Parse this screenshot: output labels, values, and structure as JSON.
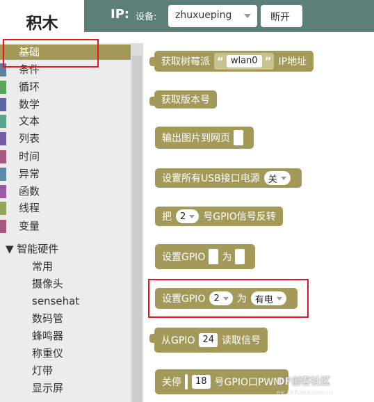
{
  "sidebar": {
    "title": "积木",
    "categories": [
      {
        "label": "基础",
        "color": "#a39a59"
      },
      {
        "label": "条件",
        "color": "#5b80a5"
      },
      {
        "label": "循环",
        "color": "#5ba55b"
      },
      {
        "label": "数学",
        "color": "#5b67a5"
      },
      {
        "label": "文本",
        "color": "#5ba58c"
      },
      {
        "label": "列表",
        "color": "#745ba5"
      },
      {
        "label": "时间",
        "color": "#a55b80"
      },
      {
        "label": "异常",
        "color": "#5b8aa5"
      },
      {
        "label": "函数",
        "color": "#995ba5"
      },
      {
        "label": "线程",
        "color": "#8fa55b"
      },
      {
        "label": "变量",
        "color": "#a55b80"
      }
    ],
    "hardware_group": "▼ 智能硬件",
    "hardware_items": [
      "常用",
      "摄像头",
      "sensehat",
      "数码管",
      "蜂鸣器",
      "称重仪",
      "灯带",
      "显示屏"
    ]
  },
  "toolbar": {
    "ip_label": "IP:",
    "device_label": "设备:",
    "device_value": "zhuxueping",
    "disconnect_label": "断开"
  },
  "blocks": {
    "b1_label": "获取树莓派",
    "b1_value": "wlan0",
    "b1_suffix": "IP地址",
    "b2_label": "获取版本号",
    "b3_label": "输出图片到网页",
    "b4_label": "设置所有USB接口电源",
    "b4_option": "关",
    "b5_prefix": "把",
    "b5_option": "2",
    "b5_suffix": "号GPIO信号反转",
    "b6_label": "设置GPIO",
    "b6_mid": "为",
    "b7_label": "设置GPIO",
    "b7_pin": "2",
    "b7_mid": "为",
    "b7_state": "有电",
    "b8_label": "从GPIO",
    "b8_pin": "24",
    "b8_suffix": "读取信号",
    "b9_label": "关停",
    "b9_pin": "18",
    "b9_suffix": "号GPIO口PWM"
  },
  "watermark": {
    "text": "DF创客社区",
    "sub": "mc.DFRobot.com.cn"
  },
  "highlight_color": "#e8141a"
}
